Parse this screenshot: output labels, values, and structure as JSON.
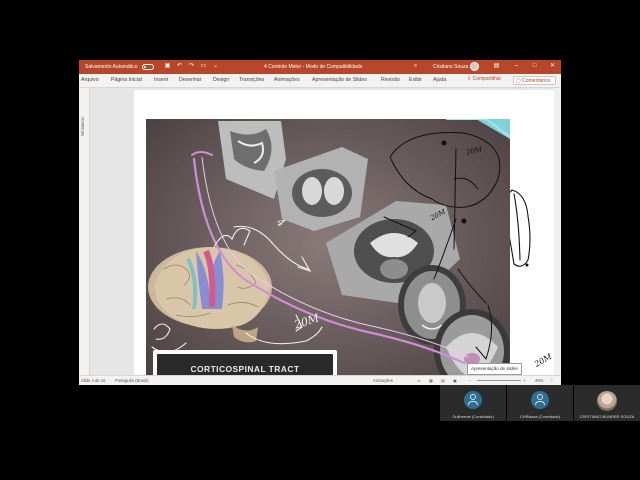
{
  "titlebar": {
    "autosave_label": "Salvamento Automático",
    "doc_title": "4 Controle Motor - Modo de Compatibilidade",
    "user_name": "Cristiano Souza"
  },
  "ribbon_tabs": [
    "Arquivo",
    "Página Inicial",
    "Inserir",
    "Desenhar",
    "Design",
    "Transições",
    "Animações",
    "Apresentação de Slides",
    "Revisão",
    "Exibir",
    "Ajuda"
  ],
  "share_label": "Compartilhar",
  "comments_label": "Comentários",
  "thumbnails_label": "Miniaturas",
  "slide": {
    "title_text": "CORTICOSPINAL TRACT",
    "annotations": [
      "4",
      "20M",
      "20M",
      "20M",
      "20M"
    ]
  },
  "status": {
    "slide_info": "Slide 4 de 15",
    "language": "Português (Brasil)",
    "notes_label": "Anotações",
    "zoom": "49%"
  },
  "tooltip": "Apresentação de slides",
  "participants": [
    {
      "name": "Guilherme (Convidado)"
    },
    {
      "name": "CHRlsara (Convidado)"
    },
    {
      "name": "CRISTIANO BUNDER SOUZA"
    }
  ],
  "colors": {
    "accent": "#b7472a",
    "slide_bg": "#5b4e4f",
    "meeting_bg": "#000000"
  }
}
